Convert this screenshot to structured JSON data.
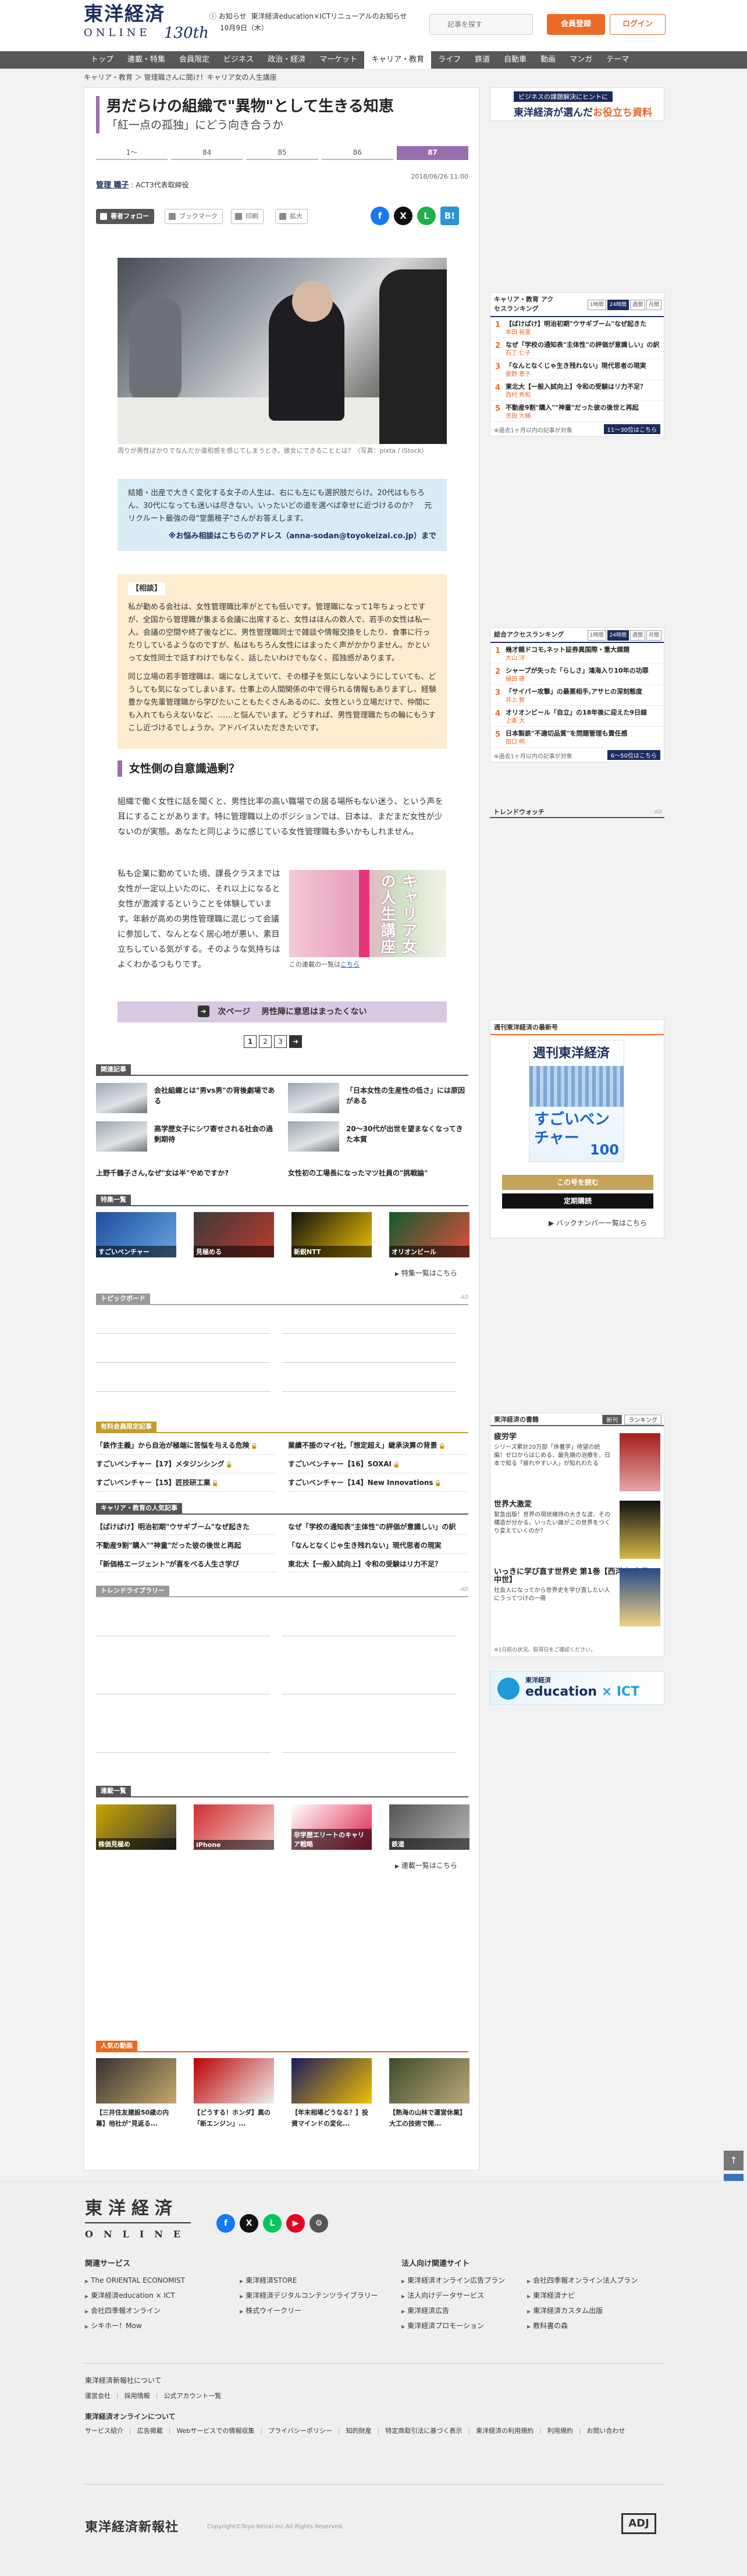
{
  "header": {
    "logo_ja": "東洋経済",
    "logo_en": "ONLINE",
    "logo_anniv": "130th",
    "notice_label": "お知らせ",
    "notice_text": "東洋経済education×ICTリニューアルのお知らせ",
    "notice_date": "10月9日（木）",
    "search_placeholder": "記事を探す",
    "register_label": "会員登録",
    "login_label": "ログイン"
  },
  "nav": [
    "トップ",
    "連載・特集",
    "会員限定",
    "ビジネス",
    "政治・経済",
    "マーケット",
    "キャリア・教育",
    "ライフ",
    "鉄道",
    "自動車",
    "動画",
    "マンガ",
    "テーマ"
  ],
  "breadcrumb": "キャリア・教育  ＞  管理職さんに聞け！キャリア女の人生講座",
  "article": {
    "title": "男だらけの組織で\"異物\"として生きる知恵",
    "subtitle": "「紅一点の孤独」にどう向き合うか",
    "pages": [
      "1～",
      "84",
      "85",
      "86",
      "87"
    ],
    "author": "管理 職子",
    "author_title": ": ACT3代表取締役",
    "date": "2018/06/26 11:00",
    "follow_label": "著者フォロー",
    "bookmark_label": "ブックマーク",
    "print_label": "印刷",
    "font_label": "拡大",
    "photo_caption": "周りが男性ばかりでなんだか違和感を感じてしまうとき。彼女にできることとは？（写真：pixta / iStock）",
    "lead": "結婚・出産で大きく変化する女子の人生は、右にも左にも選択肢だらけ。20代はもちろん、30代になっても迷いは尽きない。いったいどの道を選べば幸せに近づけるのか？　元リクルート最強の母\"堂薗稚子\"さんがお答えします。",
    "lead_mail": "※お悩み相談はこちらのアドレス（anna-sodan@toyokeizai.co.jp）まで",
    "consult_head": "【相談】",
    "consult_p1": "私が勤める会社は、女性管理職比率がとても低いです。管理職になって1年ちょっとですが、全国から管理職が集まる会議に出席すると、女性はほんの数人で、若手の女性は私一人。会議の空間や終了後などに、男性管理職同士で雑談や情報交換をしたり、食事に行ったりしているようなのですが、私はもちろん女性にはまったく声がかかりません。かといって女性同士で話すわけでもなく、話したいわけでもなく、孤独感があります。",
    "consult_p2": "同じ立場の若手管理職は、端になしえていて、その様子を気にしないようにしていても、どうしても気になってしまいます。仕事上の人間関係の中で得られる情報もありますし、経験豊かな先輩管理職から学びたいこともたくさんあるのに、女性という立場だけで、仲間にも入れてもらえないなど、……と悩んでいます。どうすれば、男性管理職たちの輪にもうすこし近づけるでしょうか。アドバイスいただきたいです。",
    "section_heading": "女性側の自意識過剰？",
    "body_p1": "組織で働く女性に話を聞くと、男性比率の高い職場での居る場所もない迷う、という声を耳にすることがあります。特に管理職以上のポジションでは、日本は、まだまだ女性が少ないのが実態。あなたと同じように感じている女性管理職も多いかもしれません。",
    "body_p2": "私も企業に勤めていた頃、課長クラスまでは女性が一定以上いたのに、それ以上になると女性が激減するということを体験しています。年齢が高めの男性管理職に混じって会議に参加して、なんとなく居心地が悪い、素目立ちしている気がする。そのような気持ちはよくわかるつもりです。",
    "book_title": "キャリア女の人生講座",
    "book_caption": "この連載の一覧は",
    "book_link": "こちら",
    "next_label": "次ページ",
    "next_text": "男性陣に意思はまったくない",
    "page_nums": [
      "1",
      "2",
      "3"
    ]
  },
  "related": {
    "head": "関連記事",
    "items": [
      {
        "text": "会社組織とは\"男vs男\"の背後劇場である"
      },
      {
        "text": "「日本女性の生産性の低さ」には原因がある"
      },
      {
        "text": "高学歴女子にシワ寄せされる社会の過剰期待"
      },
      {
        "text": "20～30代が出世を望まなくなってきた本質"
      },
      {
        "text": "上野千鶴子さん,なぜ\"女は半\"やめですか?"
      },
      {
        "text": "女性初の工場長になったマツ社員の\"挑戦論\""
      }
    ]
  },
  "feature": {
    "head": "特集一覧",
    "items": [
      "すごいベンチャー",
      "見極める",
      "新鋭NTT",
      "オリオンビール"
    ],
    "more": "特集一覧はこちら"
  },
  "topic": {
    "head": "トピックボード",
    "ad": "AD"
  },
  "premium": {
    "head": "有料会員限定記事",
    "items": [
      "「鉄作主義」から自治が極端に苦悩を与える危険",
      "業績不振のマイ社,「想定超え」継承決算の背景",
      "すごいベンチャー【17】メタジンシング",
      "すごいベンチャー【16】SOXAI",
      "すごいベンチャー【15】匠技研工業",
      "すごいベンチャー【14】New Innovations"
    ]
  },
  "career": {
    "head": "キャリア・教育の人気記事",
    "items": [
      "【ばけばけ】明治初期\"ウサギブーム\"なぜ起きた",
      "なぜ「学校の通知表\"主体性\"の評価が意識しい」の訳",
      "不動産9割\"購入\"\"神童\"だった彼の後世と再起",
      "「なんとなくじゃ生き残れない」現代思者の現実",
      "「新価格エージェント\"が喜をべる人生さ学び",
      "東北大【一般入試向上】令和の受験はリ力不足？"
    ]
  },
  "library": {
    "head": "トレンドライブラリー",
    "ad": "AD"
  },
  "series": {
    "head": "連載一覧",
    "items": [
      "株価見極め",
      "iPhone",
      "非学歴エリートのキャリア戦略",
      "鉄道"
    ],
    "more": "連載一覧はこちら"
  },
  "popular": {
    "head": "人気の動画",
    "items": [
      {
        "text": "【三井住友建設50歳の内幕】他社が\"見返る..."
      },
      {
        "text": "【どうする！ホンダ】異の「新エンジン」..."
      },
      {
        "text": "【年末相場どうなる？】投資マインドの変化..."
      },
      {
        "text": "【熱海の山林で運営休業】大工の技術で開..."
      }
    ]
  },
  "sidebar": {
    "promo_sub": "ビジネスの課題解決にヒントに",
    "promo_main": "東洋経済が選んだ",
    "promo_em": "お役立ち資料",
    "rank1": {
      "head": "キャリア・教育 アクセスランキング",
      "tabs": [
        "1時間",
        "24時間",
        "週間",
        "月間"
      ],
      "items": [
        {
          "n": "1",
          "t": "【ばけばけ】明治初期\"ウサギブーム\"なぜ起きた",
          "a": "本田 裕里"
        },
        {
          "n": "2",
          "t": "なぜ「学校の通知表\"主体性\"の評価が意識しい」の訳",
          "a": "石丁 仁子"
        },
        {
          "n": "3",
          "t": "「なんとなくじゃ生き残れない」現代思者の現実",
          "a": "星野 恵子"
        },
        {
          "n": "4",
          "t": "東北大【一般入試向上】令和の受験はリ力不足？",
          "a": "西村 秀和"
        },
        {
          "n": "5",
          "t": "不動産9割\"購入\"\"神童\"だった彼の後世と再起",
          "a": "吉田 大輔"
        }
      ],
      "foot": "※過去1ヶ月以内の記事が対象",
      "foot_btn": "11～30位はこちら"
    },
    "rank2": {
      "head": "総合アクセスランキング",
      "tabs": [
        "1時間",
        "24時間",
        "週間",
        "月間"
      ],
      "items": [
        {
          "n": "1",
          "t": "幾才親ドコモ,ネット証券異国際・重大課題",
          "a": "大山 洋"
        },
        {
          "n": "2",
          "t": "シャープが失った「らしさ」鴻海入り10年の功罪",
          "a": "樋田 康"
        },
        {
          "n": "3",
          "t": "「サイバー攻撃」の最悪相手,アサヒの深刻態度",
          "a": "井上 智"
        },
        {
          "n": "4",
          "t": "オリオンビール「自立」の18年後に迎えた9日線",
          "a": "上東 大"
        },
        {
          "n": "5",
          "t": "日本製鉄\"不適切品質\"を問題管理も責任感",
          "a": "田口 明"
        }
      ],
      "foot": "※過去1ヶ月以内の記事が対象",
      "foot_btn": "6～50位はこちら"
    },
    "trend_head": "トレンドウォッチ",
    "trend_ad": "AD",
    "mag": {
      "head": "週刊東洋経済の最新号",
      "cover_title": "週刊東洋経済",
      "cover_main": "すごいベンチャー",
      "cover_num": "100",
      "btn1": "この号を読む",
      "btn2": "定期購読",
      "btn3": "バックナンバー一覧はこちら"
    },
    "books": {
      "head": "東洋経済の書籍",
      "tabs": [
        "新刊",
        "ランキング"
      ],
      "items": [
        {
          "t": "疲労学",
          "d": "シリーズ累計20万部「休養学」待望の続編！ゼロからはじめる、最先端の治療を、日本で知る「疲れやすい人」が知れわたる"
        },
        {
          "t": "世界大激変",
          "d": "緊急出版！世界の現状維持の大きな波、その構造が分かる。いったい誰がこの世界をつくり変えていくのか？"
        },
        {
          "t": "いっきに学び直す世界史 第1巻【西洋史 古代・中世】",
          "d": "社会人になってから世界史を学び直したい人にうってつけの一冊"
        }
      ],
      "note": "※1日前の状況。取得日をご確認ください。"
    },
    "ban2_sub": "東洋経済",
    "ban2_main": "education",
    "ban2_em": "× ICT"
  },
  "footer": {
    "logo": "東洋経済",
    "logo_en": "ONLINE",
    "col1_head": "関連サービス",
    "col1": [
      "The ORIENTAL ECONOMIST",
      "東洋経済education × ICT",
      "会社四季報オンライン",
      "シキホー！Mow"
    ],
    "col2": [
      "東洋経済STORE",
      "東洋経済デジタルコンテンツライブラリー",
      "株式ウイークリー"
    ],
    "col3_head": "法人向け関連サイト",
    "col3": [
      "東洋経済オンライン広告プラン",
      "法人向けデータサービス",
      "東洋経済広告",
      "東洋経済プロモーション"
    ],
    "col4": [
      "会社四季報オンライン法人プラン",
      "東洋経済ナビ",
      "東洋経済カスタム出版",
      "教科書の森"
    ],
    "about_head": "東洋経済新報社について",
    "about": [
      "運営会社",
      "採用情報",
      "公式アカウント一覧"
    ],
    "online_head": "東洋経済オンラインについて",
    "online": [
      "サービス紹介",
      "広告掲載",
      "Webサービスでの情報収集",
      "プライバシーポリシー",
      "知的財産",
      "特定商取引法に基づく表示",
      "東洋経済の利用規約",
      "利用規約",
      "お問い合わせ"
    ],
    "corp": "東洋経済新報社",
    "copyright": "Copyright©Toyo Keizai Inc.All Rights Reserved.",
    "adj": "ADJ"
  }
}
